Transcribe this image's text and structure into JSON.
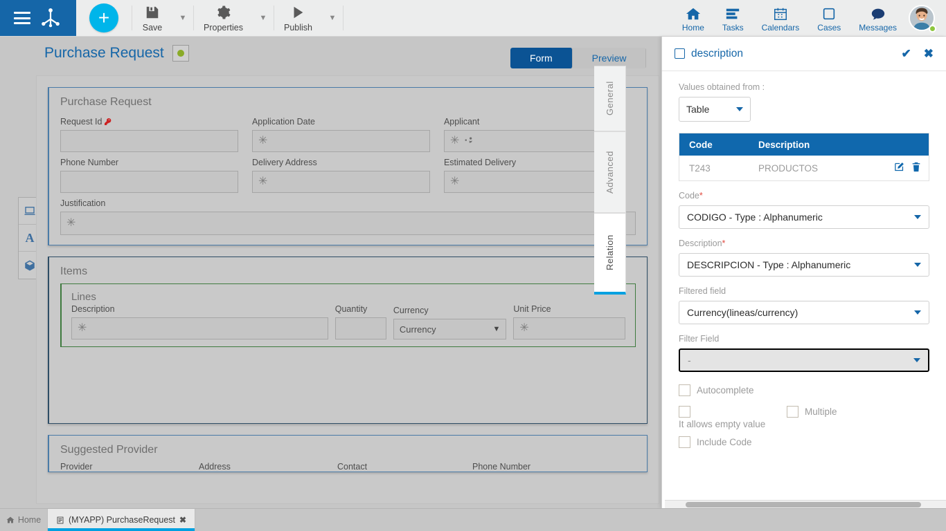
{
  "topbar": {
    "menu_icon": "hamburger-icon",
    "logo_icon": "bizagi-logo-icon",
    "add_label": "+",
    "tools": [
      {
        "label": "Save",
        "icon": "save-icon"
      },
      {
        "label": "Properties",
        "icon": "gear-icon"
      },
      {
        "label": "Publish",
        "icon": "play-icon"
      }
    ],
    "nav": [
      {
        "label": "Home",
        "icon": "home-icon"
      },
      {
        "label": "Tasks",
        "icon": "tasks-icon"
      },
      {
        "label": "Calendars",
        "icon": "calendar-icon"
      },
      {
        "label": "Cases",
        "icon": "cases-icon"
      },
      {
        "label": "Messages",
        "icon": "messages-icon"
      }
    ],
    "avatar_name": "user-avatar",
    "presence_color": "#8dc63f"
  },
  "workspace": {
    "page_title": "Purchase Request",
    "status_dot_color": "#8aab28",
    "mode_tabs": [
      {
        "label": "Form",
        "active": true
      },
      {
        "label": "Preview",
        "active": false
      }
    ],
    "left_tools": [
      {
        "icon": "display-icon"
      },
      {
        "icon": "text-a-icon"
      },
      {
        "icon": "cube-icon"
      }
    ],
    "vertical_tabs": [
      {
        "label": "General",
        "active": false
      },
      {
        "label": "Advanced",
        "active": false
      },
      {
        "label": "Relation",
        "active": true
      }
    ],
    "form": {
      "section1_title": "Purchase Request",
      "fields": [
        {
          "label": "Request Id",
          "value": "",
          "key_icon": true
        },
        {
          "label": "Application Date",
          "value": "✳"
        },
        {
          "label": "Applicant",
          "value": "✳"
        },
        {
          "label": "Phone Number",
          "value": ""
        },
        {
          "label": "Delivery Address",
          "value": "✳"
        },
        {
          "label": "Estimated Delivery",
          "value": "✳"
        }
      ],
      "justification_label": "Justification",
      "justification_value": "✳",
      "items_title": "Items",
      "lines_title": "Lines",
      "lines_columns": [
        {
          "label": "Description",
          "value": "✳",
          "type": "input"
        },
        {
          "label": "Quantity",
          "value": "",
          "type": "input"
        },
        {
          "label": "Currency",
          "value": "Currency",
          "type": "select"
        },
        {
          "label": "Unit Price",
          "value": "✳",
          "type": "input"
        }
      ],
      "provider_title": "Suggested Provider",
      "provider_columns": [
        "Provider",
        "Address",
        "Contact",
        "Phone Number"
      ]
    }
  },
  "right_panel": {
    "title": "description",
    "checkbox_checked": false,
    "confirm_icon": "check-icon",
    "close_icon": "close-icon",
    "values_from_label": "Values obtained from :",
    "values_from_value": "Table",
    "table": {
      "headers": [
        "Code",
        "Description"
      ],
      "rows": [
        {
          "code": "T243",
          "description": "PRODUCTOS",
          "edit_icon": "edit-icon",
          "delete_icon": "trash-icon"
        }
      ]
    },
    "fields": [
      {
        "label": "Code",
        "required": true,
        "value": "CODIGO - Type : Alphanumeric",
        "focused": false
      },
      {
        "label": "Description",
        "required": true,
        "value": "DESCRIPCION - Type : Alphanumeric",
        "focused": false
      },
      {
        "label": "Filtered field",
        "required": false,
        "value": "Currency(lineas/currency)",
        "focused": false
      },
      {
        "label": "Filter Field",
        "required": false,
        "value": "-",
        "focused": true
      }
    ],
    "checkboxes": [
      {
        "label": "Autocomplete",
        "checked": false
      },
      {
        "label": "",
        "checked": false
      },
      {
        "label": "Multiple",
        "checked": false
      },
      {
        "label": "Include Code",
        "checked": false
      }
    ],
    "empty_value_note": "It allows empty value",
    "accent_color": "#1068ad"
  },
  "taskbar": {
    "home_label": "Home",
    "tab_label": "(MYAPP) PurchaseRequest",
    "tab_close": "✖",
    "tab_icon": "document-icon"
  }
}
